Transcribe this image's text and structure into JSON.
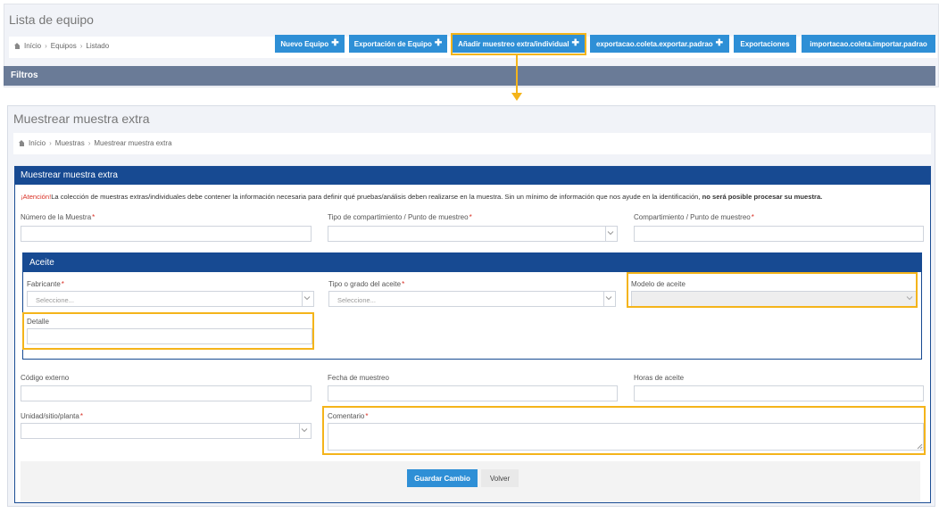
{
  "top": {
    "title": "Lista de equipo",
    "breadcrumb": [
      "Início",
      "Equipos",
      "Listado"
    ],
    "buttons": [
      {
        "label": "Nuevo Equipo",
        "icon": "plus-icon"
      },
      {
        "label": "Exportación de Equipo",
        "icon": "plus-icon"
      },
      {
        "label": "Añadir muestreo extra/individual",
        "icon": "plus-icon"
      },
      {
        "label": "exportacao.coleta.exportar.padrao",
        "icon": "plus-icon"
      },
      {
        "label": "Exportaciones"
      },
      {
        "label": "importacao.coleta.importar.padrao"
      }
    ],
    "filters_label": "Filtros"
  },
  "form_page": {
    "title": "Muestrear muestra extra",
    "breadcrumb": [
      "Início",
      "Muestras",
      "Muestrear muestra extra"
    ],
    "section_title": "Muestrear muestra extra",
    "notice": {
      "attention": "¡Atención!",
      "text": "La colección de muestras extras/individuales debe contener la información necesaria para definir qué pruebas/análisis deben realizarse en la muestra. Sin un mínimo de información que nos ayude en la identificación,",
      "bold": "no será posible procesar su muestra."
    },
    "fields": {
      "numero_muestra": "Número de la Muestra",
      "tipo_compartimiento": "Tipo de compartimiento / Punto de muestreo",
      "compartimiento": "Compartimiento / Punto de muestreo",
      "codigo_externo": "Código externo",
      "fecha_muestreo": "Fecha de muestreo",
      "horas_aceite": "Horas de aceite",
      "unidad": "Unidad/sitio/planta",
      "comentario": "Comentario"
    },
    "aceite": {
      "title": "Aceite",
      "fabricante": "Fabricante",
      "tipo_grado": "Tipo o grado del aceite",
      "modelo": "Modelo de aceite",
      "detalle": "Detalle",
      "select_placeholder": "Seleccione..."
    },
    "required_mark": "*",
    "save_label": "Guardar Cambio",
    "back_label": "Volver"
  },
  "colors": {
    "primary_button": "#2e8fd6",
    "header_blue": "#174a92",
    "filters_bar": "#6a7b97",
    "highlight": "#f4b41a",
    "required": "#d93025"
  }
}
